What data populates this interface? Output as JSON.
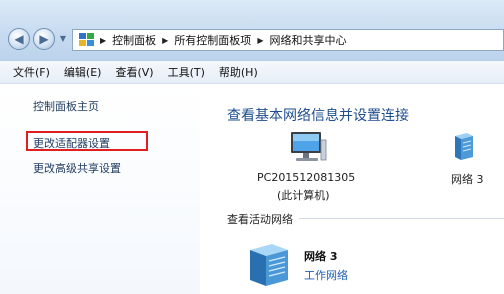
{
  "window": {
    "breadcrumbs": [
      "控制面板",
      "所有控制面板项",
      "网络和共享中心"
    ]
  },
  "menu": {
    "items": [
      "文件(F)",
      "编辑(E)",
      "查看(V)",
      "工具(T)",
      "帮助(H)"
    ]
  },
  "sidebar": {
    "items": [
      {
        "label": "控制面板主页"
      },
      {
        "label": "更改适配器设置"
      },
      {
        "label": "更改高级共享设置"
      }
    ]
  },
  "main": {
    "title": "查看基本网络信息并设置连接",
    "computer_name": "PC201512081305",
    "computer_sub": "(此计算机)",
    "network_short": "网络  3",
    "active_section_label": "查看活动网络",
    "active_network": {
      "name": "网络  3",
      "type": "工作网络"
    }
  },
  "colors": {
    "highlight": "#e02020",
    "title": "#1e4d8c",
    "link": "#1e5fb4"
  }
}
